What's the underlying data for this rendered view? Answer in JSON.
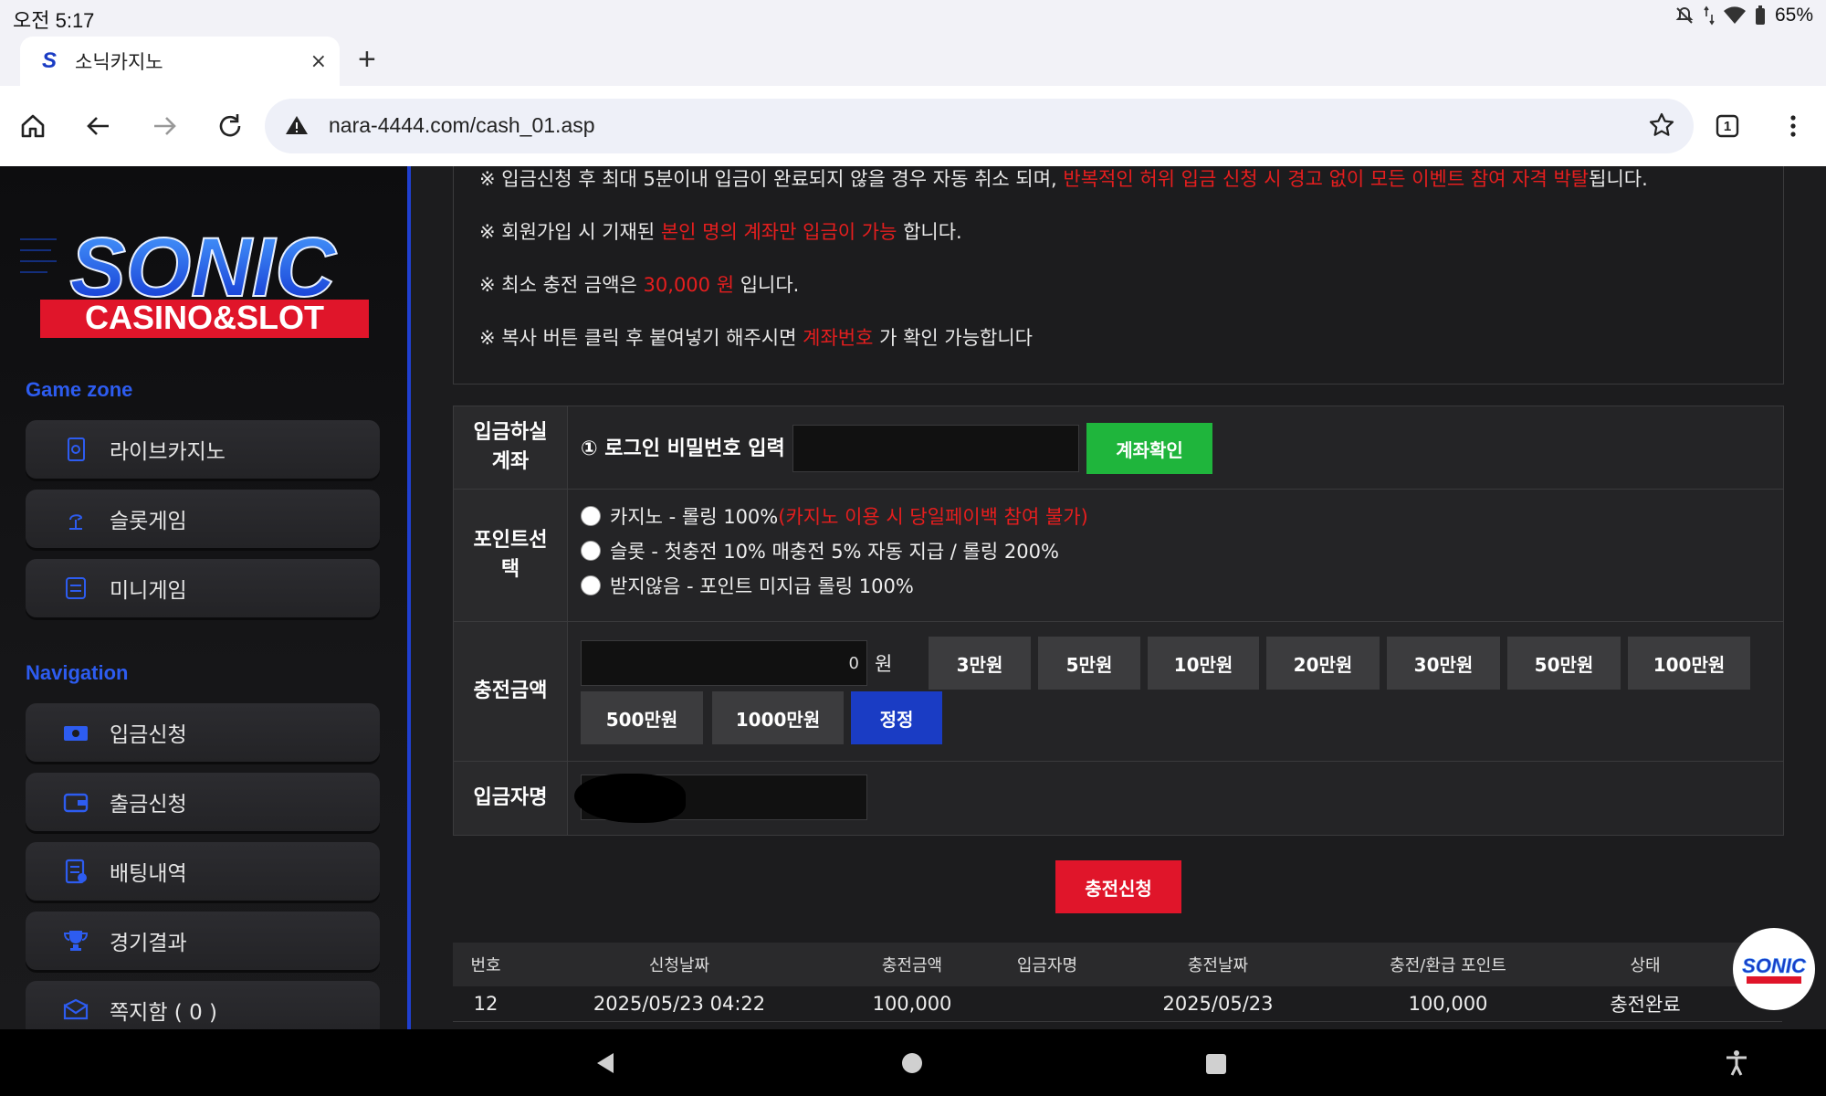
{
  "status_bar": {
    "time": "오전 5:17",
    "battery": "65%"
  },
  "browser": {
    "tab_title": "소닉카지노",
    "tab_favicon_letter": "S",
    "new_tab": "+",
    "close_tab": "×",
    "url": "nara-4444.com/cash_01.asp",
    "tab_count": "1"
  },
  "sidebar": {
    "logo_line1": "SONIC",
    "logo_line2": "CASINO&SLOT",
    "game_zone_title": "Game zone",
    "game_zone": [
      {
        "label": "라이브카지노",
        "icon": "cards-icon"
      },
      {
        "label": "슬롯게임",
        "icon": "slot-icon"
      },
      {
        "label": "미니게임",
        "icon": "mini-game-icon"
      }
    ],
    "navigation_title": "Navigation",
    "navigation": [
      {
        "label": "입금신청",
        "icon": "deposit-icon"
      },
      {
        "label": "출금신청",
        "icon": "wallet-icon"
      },
      {
        "label": "배팅내역",
        "icon": "history-icon"
      },
      {
        "label": "경기결과",
        "icon": "trophy-icon"
      },
      {
        "label": "쪽지함 ( 0 )",
        "icon": "message-icon"
      }
    ]
  },
  "notices": [
    {
      "prefix": "※ 입금신청 후 최대 5분이내 입금이 완료되지 않을 경우 자동 취소 되며, ",
      "highlight": "반복적인 허위 입금 신청 시 경고 없이 모든 이벤트 참여 자격 박탈",
      "suffix": "됩니다."
    },
    {
      "prefix": "※ 회원가입 시 기재된 ",
      "highlight": "본인 명의 계좌만 입금이 가능",
      "suffix": " 합니다."
    },
    {
      "prefix": "※ 최소 충전 금액은 ",
      "highlight": "30,000 원",
      "suffix": " 입니다."
    },
    {
      "prefix": "※ 복사 버튼 클릭 후 붙여넣기 해주시면 ",
      "highlight": "계좌번호",
      "suffix": " 가 확인 가능합니다"
    }
  ],
  "form": {
    "account_label_1": "입금하실",
    "account_label_2": "계좌",
    "password_prompt": "① 로그인 비밀번호 입력",
    "account_check_button": "계좌확인",
    "point_label_1": "포인트선",
    "point_label_2": "택",
    "point_options": [
      {
        "text": "카지노 - 롤링 100%",
        "note": " (카지노 이용 시 당일페이백 참여 불가)"
      },
      {
        "text": "슬롯 - 첫충전 10% 매충전 5% 자동 지급 / 롤링 200%",
        "note": ""
      },
      {
        "text": "받지않음 - 포인트 미지급 롤링 100%",
        "note": ""
      }
    ],
    "amount_label": "충전금액",
    "amount_value": "0",
    "amount_unit": "원",
    "amount_buttons_row1": [
      "3만원",
      "5만원",
      "10만원",
      "20만원",
      "30만원",
      "50만원",
      "100만원"
    ],
    "amount_buttons_row2": [
      "500만원",
      "1000만원"
    ],
    "correct_button": "정정",
    "depositor_label": "입금자명",
    "submit_button": "충전신청"
  },
  "history": {
    "headers": [
      "번호",
      "신청날짜",
      "충전금액",
      "입금자명",
      "충전날짜",
      "충전/환급 포인트",
      "상태"
    ],
    "rows": [
      [
        "12",
        "2025/05/23 04:22",
        "100,000",
        "",
        "2025/05/23",
        "100,000",
        "충전완료"
      ]
    ]
  },
  "float_logo_text": "SONIC",
  "colors": {
    "accent_blue": "#2d5cf0",
    "warning_red": "#e61e1e",
    "confirm_green": "#1fb53c",
    "submit_red": "#e0152a",
    "correct_blue": "#1a3cc4"
  }
}
